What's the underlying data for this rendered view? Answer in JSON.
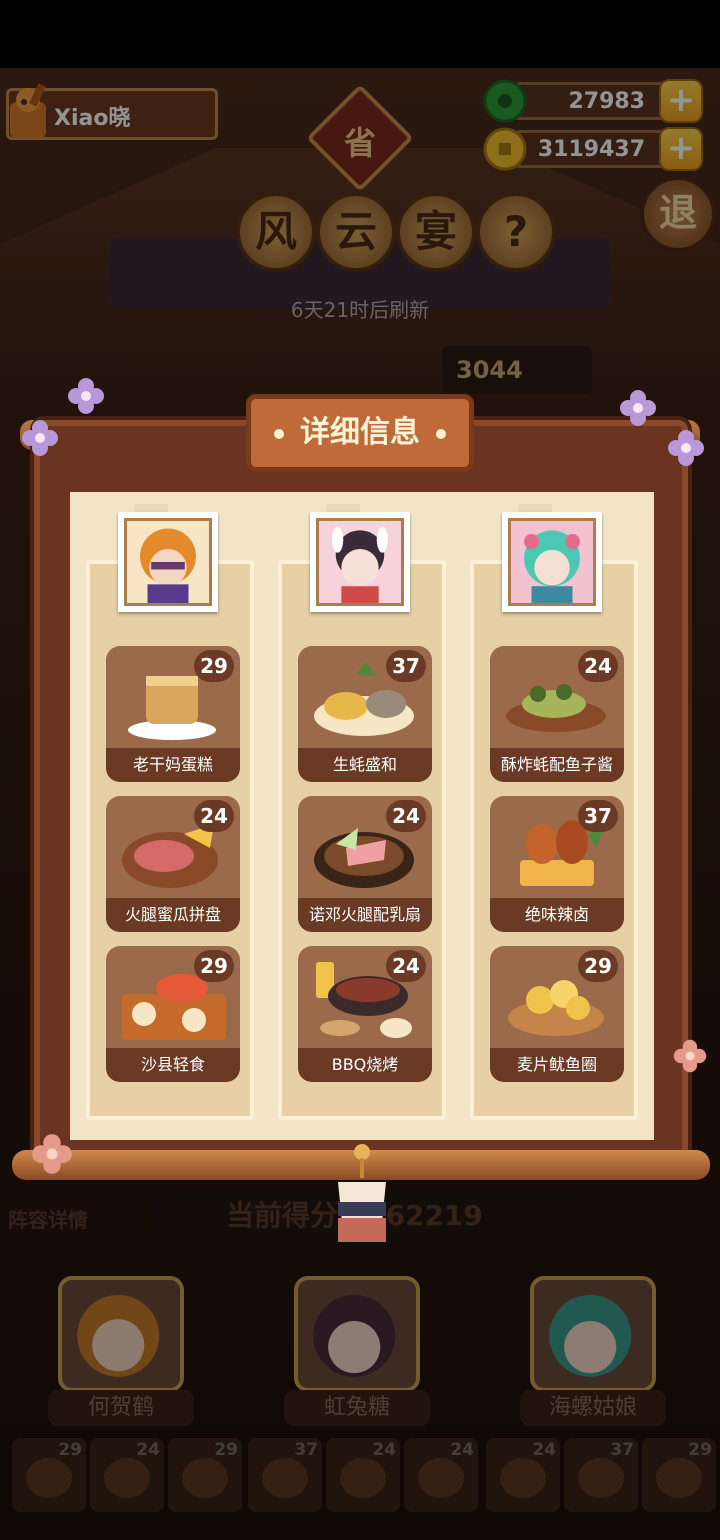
{
  "player": {
    "name": "Xiao晓"
  },
  "currencies": [
    {
      "id": "jade",
      "value": "27983",
      "color": "#2e9a3c"
    },
    {
      "id": "gold",
      "value": "3119437",
      "color": "#e7b21c"
    }
  ],
  "event": {
    "badge": "省",
    "title_chars": [
      "风",
      "云",
      "宴"
    ],
    "help_icon": "?",
    "exit_label": "退",
    "refresh_text": "6天21时后刷新",
    "score_partial": "3044"
  },
  "modal": {
    "title": "详细信息",
    "columns": [
      {
        "character": "何贺鹤",
        "portrait_color": "#e58a2a",
        "dishes": [
          {
            "name": "老干妈蛋糕",
            "score": "29",
            "color": "#d9a55a"
          },
          {
            "name": "火腿蜜瓜拼盘",
            "score": "24",
            "color": "#c45a4a"
          },
          {
            "name": "沙县轻食",
            "score": "29",
            "color": "#e68a3a"
          }
        ]
      },
      {
        "character": "虹兔糖",
        "portrait_color": "#f2b6c6",
        "dishes": [
          {
            "name": "生蚝盛和",
            "score": "37",
            "color": "#e6b84a"
          },
          {
            "name": "诺邓火腿配乳扇",
            "score": "24",
            "color": "#7a4a2a"
          },
          {
            "name": "BBQ烧烤",
            "score": "24",
            "color": "#8a3a2a"
          }
        ]
      },
      {
        "character": "海螺姑娘",
        "portrait_color": "#5ac8b8",
        "dishes": [
          {
            "name": "酥炸蚝配鱼子酱",
            "score": "24",
            "color": "#a6b45a"
          },
          {
            "name": "绝味辣卤",
            "score": "37",
            "color": "#c4642a"
          },
          {
            "name": "麦片鱿鱼圈",
            "score": "29",
            "color": "#f0c44a"
          }
        ]
      }
    ]
  },
  "bottom": {
    "lineup_label": "阵容详情",
    "current_score_text": "当前得分：662219",
    "characters": [
      "何贺鹤",
      "虹兔糖",
      "海螺姑娘"
    ],
    "mini_scores": [
      "29",
      "24",
      "29",
      "37",
      "24",
      "24",
      "24",
      "37",
      "29"
    ]
  }
}
